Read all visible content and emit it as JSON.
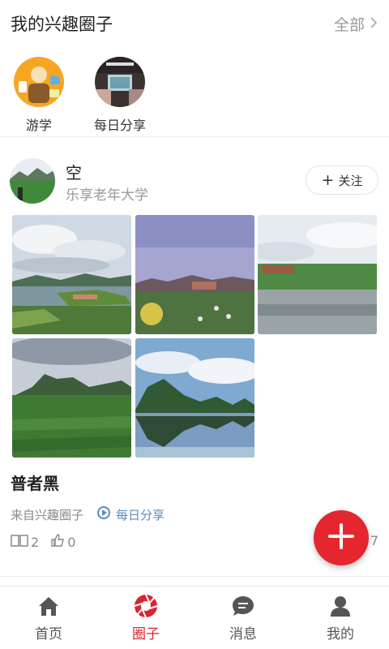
{
  "header": {
    "title": "我的兴趣圈子",
    "all_label": "全部"
  },
  "circles": [
    {
      "name": "游学"
    },
    {
      "name": "每日分享"
    }
  ],
  "post": {
    "username": "空",
    "organization": "乐享老年大学",
    "follow_label": "关注",
    "title": "普者黑",
    "source_prefix": "来自兴趣圈子",
    "circle_name": "每日分享",
    "read_count": "2",
    "like_count": "0",
    "date_visible": "20      7"
  },
  "tabs": [
    {
      "label": "首页"
    },
    {
      "label": "圈子"
    },
    {
      "label": "消息"
    },
    {
      "label": "我的"
    }
  ],
  "colors": {
    "accent": "#e5262f",
    "active_tab": "#d8262f",
    "link": "#5a8bc0",
    "muted": "#999999"
  },
  "icons": {
    "all": "chevron-right-icon",
    "follow": "plus-icon",
    "circle": "circle-badge-icon",
    "read": "book-icon",
    "like": "thumbs-up-icon",
    "fab": "plus-icon",
    "tabs": [
      "home-icon",
      "aperture-icon",
      "chat-bubble-icon",
      "user-icon"
    ]
  }
}
